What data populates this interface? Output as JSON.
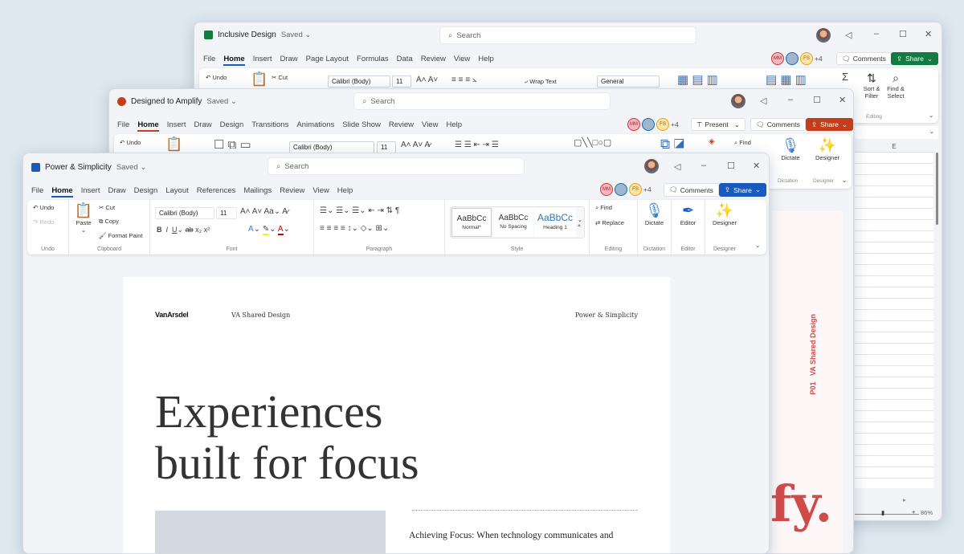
{
  "excel": {
    "title": "Inclusive Design",
    "saved": "Saved",
    "search": "Search",
    "tabs": [
      "File",
      "Home",
      "Insert",
      "Draw",
      "Page Layout",
      "Formulas",
      "Data",
      "Review",
      "View",
      "Help"
    ],
    "collaborators": [
      "MM",
      "FS"
    ],
    "extra": "+4",
    "comments": "Comments",
    "share": "Share",
    "ribbon": {
      "undo": "Undo",
      "cut": "Cut",
      "font": "Calibri (Body)",
      "size": "11",
      "wrap_text": "Wrap Text",
      "number_format": "General",
      "sort_filter": "Sort & Filter",
      "find_select": "Find & Select",
      "editing_group": "Editing"
    },
    "column": "E",
    "zoom": "86%"
  },
  "ppt": {
    "title": "Designed to Amplify",
    "saved": "Saved",
    "search": "Search",
    "tabs": [
      "File",
      "Home",
      "Insert",
      "Draw",
      "Design",
      "Transitions",
      "Animations",
      "Slide Show",
      "Review",
      "View",
      "Help"
    ],
    "collaborators": [
      "MM",
      "FS"
    ],
    "extra": "+4",
    "present": "Present",
    "comments": "Comments",
    "share": "Share",
    "ribbon": {
      "undo": "Undo",
      "font": "Calibri (Body)",
      "size": "11",
      "find": "Find",
      "dictate": "Dictate",
      "designer": "Designer",
      "dictation_group": "Dictation",
      "designer_group": "Designer"
    },
    "slide": {
      "code": "P01",
      "side_text": "VA Shared Design",
      "big_text": "fy."
    }
  },
  "word": {
    "title": "Power & Simplicity",
    "saved": "Saved",
    "search": "Search",
    "tabs": [
      "File",
      "Home",
      "Insert",
      "Draw",
      "Design",
      "Layout",
      "References",
      "Mailings",
      "Review",
      "View",
      "Help"
    ],
    "collaborators": [
      "MM",
      "FS"
    ],
    "extra": "+4",
    "comments": "Comments",
    "share": "Share",
    "ribbon": {
      "undo": "Undo",
      "redo": "Redo",
      "undo_group": "Undo",
      "paste": "Paste",
      "cut": "Cut",
      "copy": "Copy",
      "format_paint": "Format Paint",
      "clipboard_group": "Clipboard",
      "font": "Calibri (Body)",
      "size": "11",
      "font_group": "Font",
      "paragraph_group": "Paragraph",
      "styles": [
        {
          "sample": "AaBbCc",
          "name": "Normal*"
        },
        {
          "sample": "AaBbCc",
          "name": "No Spacing"
        },
        {
          "sample": "AaBbCc",
          "name": "Heading 1"
        }
      ],
      "style_group": "Style",
      "find": "Find",
      "replace": "Replace",
      "editing_group": "Editing",
      "dictate": "Dictate",
      "dictation_group": "Dictation",
      "editor": "Editor",
      "editor_group": "Editor",
      "designer": "Designer",
      "designer_group": "Designer"
    },
    "document": {
      "logo": "VanArsdel",
      "header_center": "VA Shared Design",
      "header_right": "Power & Simplicity",
      "headline_1": "Experiences",
      "headline_2": "built for focus",
      "body": "Achieving Focus: When technology communicates and"
    }
  },
  "colors": {
    "word": "#185abd",
    "excel": "#107c41",
    "ppt": "#c43e1c",
    "slide_accent": "#d04a4a"
  }
}
